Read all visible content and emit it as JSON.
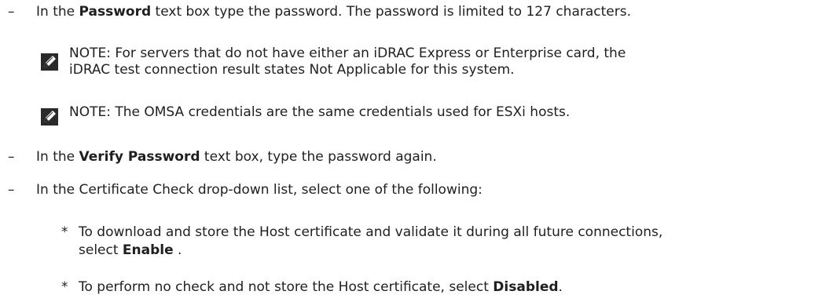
{
  "items": [
    {
      "marker": "–",
      "pre": "In the ",
      "bold": "Password",
      "post": " text box type the password. The password is limited to 127 characters."
    }
  ],
  "notes": [
    {
      "icon": "pencil-note-icon",
      "label": "NOTE:",
      "line1": " For servers that do not have either an iDRAC Express or Enterprise card, the",
      "line2": "iDRAC test connection result states Not Applicable for this system."
    },
    {
      "icon": "pencil-note-icon",
      "label": "NOTE:",
      "line1": " The OMSA credentials are the same credentials used for ESXi hosts."
    }
  ],
  "items2": [
    {
      "marker": "–",
      "pre": "In the ",
      "bold": "Verify Password",
      "post": " text box, type the password again."
    },
    {
      "marker": "–",
      "text": "In the Certificate Check drop-down list, select one of the following:"
    }
  ],
  "subitems": [
    {
      "marker": "*",
      "line1": "To download and store the Host certificate and validate it during all future connections,",
      "line2_pre": "select ",
      "line2_bold": "Enable",
      "line2_post": " ."
    },
    {
      "marker": "*",
      "pre": "To perform no check and not store the Host certificate, select ",
      "bold": "Disabled",
      "post": "."
    }
  ]
}
